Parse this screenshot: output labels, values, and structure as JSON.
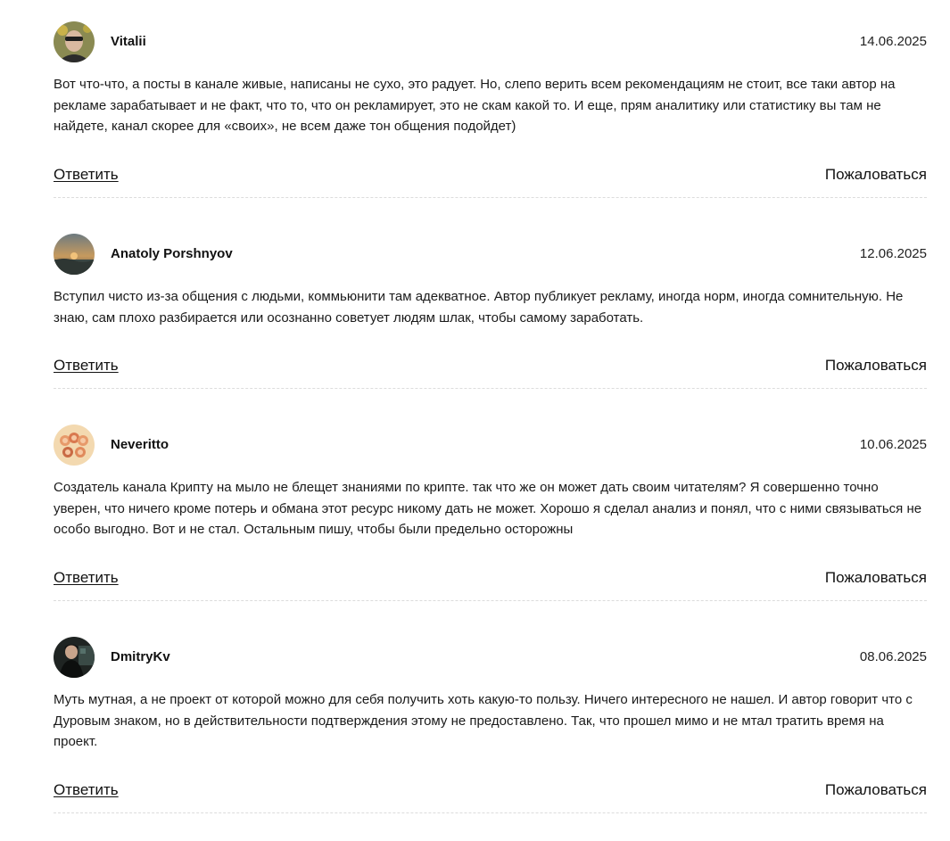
{
  "comments": [
    {
      "author": "Vitalii",
      "date": "14.06.2025",
      "text": "Вот что-что, а посты в канале живые, написаны не сухо, это радует. Но, слепо верить всем рекомендациям не стоит, все таки автор на рекламе зарабатывает и не факт, что то, что он рекламирует, это не скам какой то. И еще, прям аналитику или статистику вы там не найдете, канал скорее для «своих», не всем даже тон общения подойдет)",
      "reply_label": "Ответить",
      "report_label": "Пожаловаться"
    },
    {
      "author": "Anatoly Porshnyov",
      "date": "12.06.2025",
      "text": "Вступил чисто из-за общения с людьми, коммьюнити там адекватное. Автор публикует рекламу, иногда норм, иногда сомнительную. Не знаю, сам плохо разбирается или осознанно советует людям шлак, чтобы самому заработать.",
      "reply_label": "Ответить",
      "report_label": "Пожаловаться"
    },
    {
      "author": "Neveritto",
      "date": "10.06.2025",
      "text": "Создатель канала Крипту на мыло не блещет знаниями по крипте. так что же он может дать своим читателям? Я совершенно точно уверен, что ничего кроме потерь и обмана этот ресурс никому дать не может. Хорошо я сделал анализ и понял, что с ними связываться не особо выгодно. Вот и не стал. Остальным пишу, чтобы были предельно осторожны",
      "reply_label": "Ответить",
      "report_label": "Пожаловаться"
    },
    {
      "author": "DmitryKv",
      "date": "08.06.2025",
      "text": "Муть мутная, а не проект от которой можно для себя получить хоть какую-то пользу. Ничего интересного не нашел. И автор говорит что с Дуровым знаком, но в действительности подтверждения этому не предоставлено. Так, что прошел мимо и не мтал тратить время на проект.",
      "reply_label": "Ответить",
      "report_label": "Пожаловаться"
    }
  ]
}
